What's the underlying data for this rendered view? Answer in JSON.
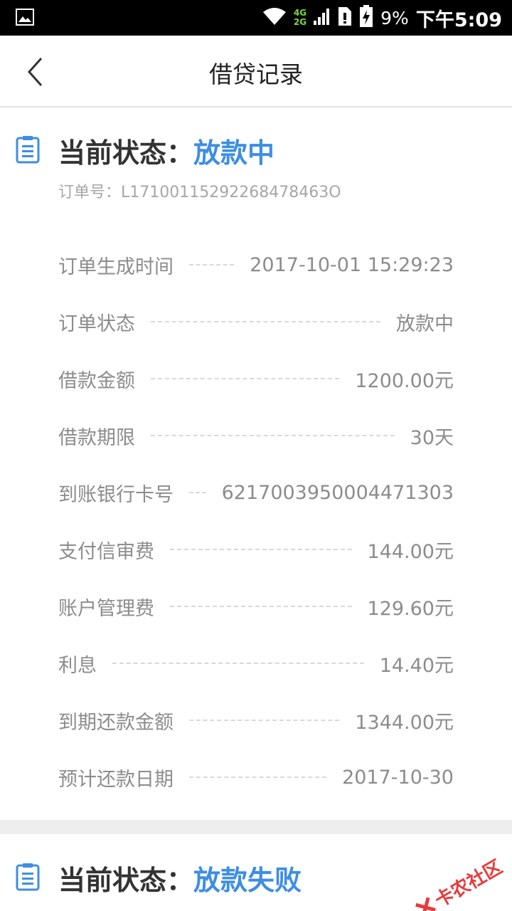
{
  "status_bar": {
    "battery": "9%",
    "time": "下午5:09",
    "net_top": "4G",
    "net_bottom": "2G"
  },
  "header": {
    "title": "借贷记录"
  },
  "record1": {
    "status_label": "当前状态：",
    "status_value": "放款中",
    "order_no": "订单号：L17100115292268478463O",
    "rows": [
      {
        "label": "订单生成时间",
        "value": "2017-10-01 15:29:23"
      },
      {
        "label": "订单状态",
        "value": "放款中"
      },
      {
        "label": "借款金额",
        "value": "1200.00元"
      },
      {
        "label": "借款期限",
        "value": "30天"
      },
      {
        "label": "到账银行卡号",
        "value": "6217003950004471303"
      },
      {
        "label": "支付信审费",
        "value": "144.00元"
      },
      {
        "label": "账户管理费",
        "value": "129.60元"
      },
      {
        "label": "利息",
        "value": "14.40元"
      },
      {
        "label": "到期还款金额",
        "value": "1344.00元"
      },
      {
        "label": "预计还款日期",
        "value": "2017-10-30"
      }
    ]
  },
  "record2": {
    "status_label": "当前状态：",
    "status_value": "放款失败"
  },
  "watermark": {
    "text": "卡农社区"
  },
  "colors": {
    "accent": "#3d8ee3",
    "text_muted": "#8c8c8c",
    "watermark": "#e83a3a"
  }
}
